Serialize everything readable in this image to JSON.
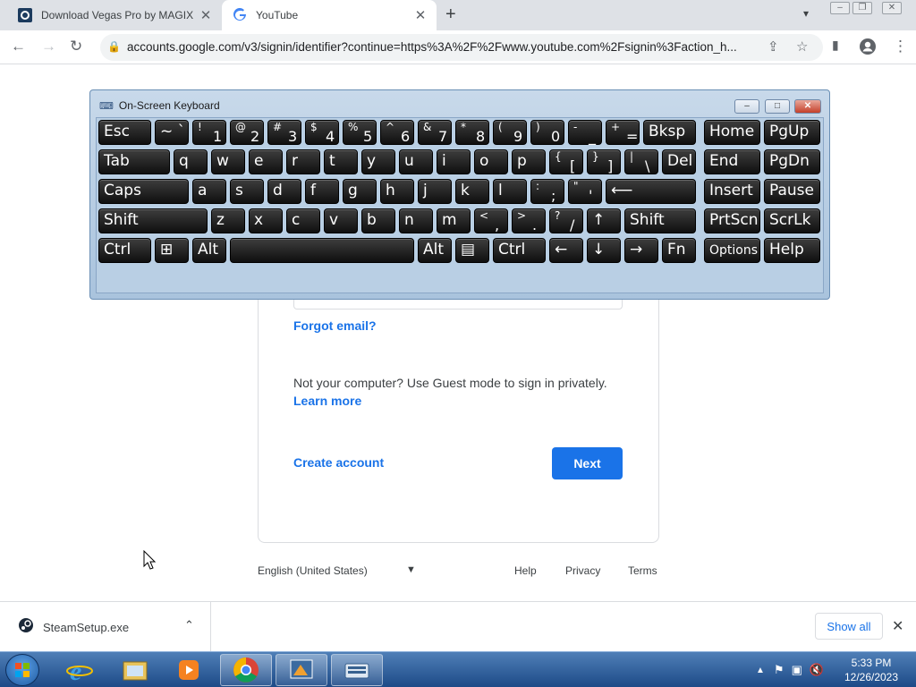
{
  "browser": {
    "tabs": [
      {
        "title": "Download Vegas Pro by MAGIX /",
        "active": false
      },
      {
        "title": "YouTube",
        "active": true
      }
    ],
    "url": "accounts.google.com/v3/signin/identifier?continue=https%3A%2F%2Fwww.youtube.com%2Fsignin%3Faction_h..."
  },
  "signin": {
    "forgot_email": "Forgot email?",
    "guest_text": "Not your computer? Use Guest mode to sign in privately.",
    "learn_more": "Learn more",
    "create_account": "Create account",
    "next": "Next"
  },
  "footer": {
    "language": "English (United States)",
    "help": "Help",
    "privacy": "Privacy",
    "terms": "Terms"
  },
  "downloads": {
    "file": "SteamSetup.exe",
    "show_all": "Show all"
  },
  "osk": {
    "title": "On-Screen Keyboard",
    "rows": [
      [
        {
          "m": "Esc"
        },
        {
          "m": "~ `"
        },
        {
          "sh": "!",
          "lo": "1"
        },
        {
          "sh": "@",
          "lo": "2"
        },
        {
          "sh": "#",
          "lo": "3"
        },
        {
          "sh": "$",
          "lo": "4"
        },
        {
          "sh": "%",
          "lo": "5"
        },
        {
          "sh": "^",
          "lo": "6"
        },
        {
          "sh": "&",
          "lo": "7"
        },
        {
          "sh": "*",
          "lo": "8"
        },
        {
          "sh": "(",
          "lo": "9"
        },
        {
          "sh": ")",
          "lo": "0"
        },
        {
          "sh": "-",
          "lo": "_"
        },
        {
          "sh": "+",
          "lo": "="
        },
        {
          "m": "Bksp"
        },
        {
          "m": "Home"
        },
        {
          "m": "PgUp"
        }
      ],
      [
        {
          "m": "Tab"
        },
        {
          "m": "q"
        },
        {
          "m": "w"
        },
        {
          "m": "e"
        },
        {
          "m": "r"
        },
        {
          "m": "t"
        },
        {
          "m": "y"
        },
        {
          "m": "u"
        },
        {
          "m": "i"
        },
        {
          "m": "o"
        },
        {
          "m": "p"
        },
        {
          "sh": "{",
          "lo": "["
        },
        {
          "sh": "}",
          "lo": "]"
        },
        {
          "sh": "|",
          "lo": "\\"
        },
        {
          "m": "Del"
        },
        {
          "m": "End"
        },
        {
          "m": "PgDn"
        }
      ],
      [
        {
          "m": "Caps"
        },
        {
          "m": "a"
        },
        {
          "m": "s"
        },
        {
          "m": "d"
        },
        {
          "m": "f"
        },
        {
          "m": "g"
        },
        {
          "m": "h"
        },
        {
          "m": "j"
        },
        {
          "m": "k"
        },
        {
          "m": "l"
        },
        {
          "sh": ":",
          "lo": ";"
        },
        {
          "sh": "\"",
          "lo": "'"
        },
        {
          "m": "⟵"
        },
        {
          "m": "Insert"
        },
        {
          "m": "Pause"
        }
      ],
      [
        {
          "m": "Shift"
        },
        {
          "m": "z"
        },
        {
          "m": "x"
        },
        {
          "m": "c"
        },
        {
          "m": "v"
        },
        {
          "m": "b"
        },
        {
          "m": "n"
        },
        {
          "m": "m"
        },
        {
          "sh": "<",
          "lo": ","
        },
        {
          "sh": ">",
          "lo": "."
        },
        {
          "sh": "?",
          "lo": "/"
        },
        {
          "m": "↑"
        },
        {
          "m": "Shift"
        },
        {
          "m": "PrtScn"
        },
        {
          "m": "ScrLk"
        }
      ],
      [
        {
          "m": "Ctrl"
        },
        {
          "m": "⊞"
        },
        {
          "m": "Alt"
        },
        {
          "m": ""
        },
        {
          "m": "Alt"
        },
        {
          "m": "▤"
        },
        {
          "m": "Ctrl"
        },
        {
          "m": "←"
        },
        {
          "m": "↓"
        },
        {
          "m": "→"
        },
        {
          "m": "Fn"
        },
        {
          "m": "Options"
        },
        {
          "m": "Help"
        }
      ]
    ]
  },
  "taskbar": {
    "time": "5:33 PM",
    "date": "12/26/2023"
  },
  "colors": {
    "google_blue": "#1a73e8",
    "osk_frame": "#b9cfe4",
    "taskbar": "#1d4a87"
  }
}
